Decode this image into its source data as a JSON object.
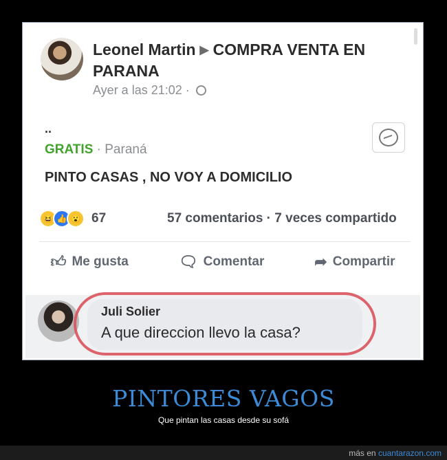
{
  "post": {
    "author": "Leonel Martin",
    "group": "COMPRA VENTA EN PARANA",
    "time": "Ayer a las 21:02 ·",
    "dots": "..",
    "price": "GRATIS",
    "location": "· Paraná",
    "body": "PINTO CASAS , NO VOY A DOMICILIO",
    "reaction_count": "67",
    "stats": "57 comentarios · 7 veces compartido"
  },
  "actions": {
    "like": "Me gusta",
    "comment": "Comentar",
    "share": "Compartir"
  },
  "comment": {
    "name": "Juli Solier",
    "text": "A que direccion llevo la casa?"
  },
  "caption": {
    "title": "PINTORES VAGOS",
    "subtitle": "Que pintan las casas desde su sofá"
  },
  "footer": {
    "prefix": "más en",
    "site": "cuantarazon.com"
  },
  "colors": {
    "price_green": "#42a32c",
    "highlight_red": "#d9535d",
    "caption_blue": "#3d8bd6"
  }
}
